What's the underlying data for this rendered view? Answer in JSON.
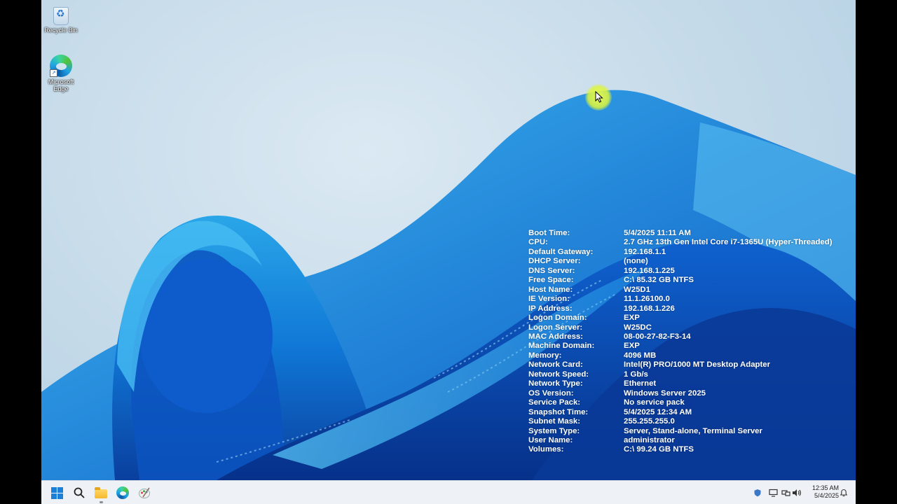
{
  "desktop": {
    "icons": [
      {
        "label": "Recycle Bin",
        "icon": "recycle-bin-icon"
      },
      {
        "label": "Microsoft Edge",
        "icon": "edge-icon"
      }
    ]
  },
  "bginfo": {
    "rows": [
      {
        "key": "Boot Time:",
        "value": "5/4/2025 11:11 AM"
      },
      {
        "key": "CPU:",
        "value": "2.7 GHz 13th Gen Intel Core i7-1365U (Hyper-Threaded)"
      },
      {
        "key": "Default Gateway:",
        "value": "192.168.1.1"
      },
      {
        "key": "DHCP Server:",
        "value": "(none)"
      },
      {
        "key": "DNS Server:",
        "value": "192.168.1.225"
      },
      {
        "key": "Free Space:",
        "value": "C:\\ 85.32 GB NTFS"
      },
      {
        "key": "Host Name:",
        "value": "W25D1"
      },
      {
        "key": "IE Version:",
        "value": "11.1.26100.0"
      },
      {
        "key": "IP Address:",
        "value": "192.168.1.226"
      },
      {
        "key": "Logon Domain:",
        "value": "EXP"
      },
      {
        "key": "Logon Server:",
        "value": "W25DC"
      },
      {
        "key": "MAC Address:",
        "value": "08-00-27-82-F3-14"
      },
      {
        "key": "Machine Domain:",
        "value": "EXP"
      },
      {
        "key": "Memory:",
        "value": "4096 MB"
      },
      {
        "key": "Network Card:",
        "value": "Intel(R) PRO/1000 MT Desktop Adapter"
      },
      {
        "key": "Network Speed:",
        "value": "1 Gb/s"
      },
      {
        "key": "Network Type:",
        "value": "Ethernet"
      },
      {
        "key": "OS Version:",
        "value": "Windows Server 2025"
      },
      {
        "key": "Service Pack:",
        "value": "No service pack"
      },
      {
        "key": "Snapshot Time:",
        "value": "5/4/2025 12:34 AM"
      },
      {
        "key": "Subnet Mask:",
        "value": "255.255.255.0"
      },
      {
        "key": "System Type:",
        "value": "Server, Stand-alone, Terminal Server"
      },
      {
        "key": "User Name:",
        "value": "administrator"
      },
      {
        "key": "Volumes:",
        "value": "C:\\ 99.24 GB NTFS"
      }
    ]
  },
  "taskbar": {
    "buttons": [
      {
        "name": "start-button",
        "icon": "windows-logo-icon"
      },
      {
        "name": "search-button",
        "icon": "search-icon"
      },
      {
        "name": "file-explorer-button",
        "icon": "folder-icon"
      },
      {
        "name": "edge-button",
        "icon": "edge-icon"
      },
      {
        "name": "paint-button",
        "icon": "paint-icon"
      }
    ],
    "tray": [
      {
        "icon": "shield-icon"
      },
      {
        "icon": "monitor-icon"
      },
      {
        "icon": "network-icon"
      },
      {
        "icon": "volume-icon"
      }
    ],
    "clock": {
      "time": "12:35 AM",
      "date": "5/4/2025"
    }
  },
  "colors": {
    "accent": "#1d7fd6",
    "wallpaper_light": "#c8dcea",
    "wallpaper_deep": "#0a4fb0",
    "taskbar": "#eef1f5",
    "cursor_highlight": "#e8ff50"
  }
}
